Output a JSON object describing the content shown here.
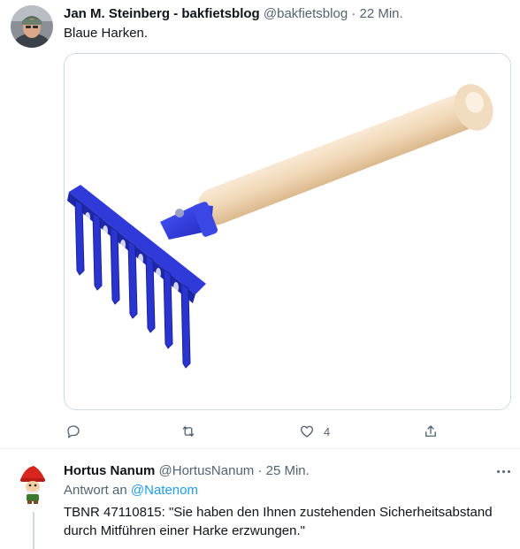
{
  "tweets": [
    {
      "author_name": "Jan M. Steinberg - bakfietsblog",
      "author_handle": "@bakfietsblog",
      "separator": "·",
      "time": "22 Min.",
      "text": "Blaue Harken.",
      "actions": {
        "reply_count": "",
        "retweet_count": "",
        "like_count": "4"
      }
    },
    {
      "author_name": "Hortus Nanum",
      "author_handle": "@HortusNanum",
      "separator": "·",
      "time": "25 Min.",
      "reply_prefix": "Antwort an",
      "reply_mention": "@Natenom",
      "text": "TBNR 47110815: \"Sie haben den Ihnen zustehenden Sicherheitsabstand durch Mitführen einer Harke erzwungen.\""
    }
  ],
  "icons": [
    "avatar-photo",
    "reply-icon",
    "retweet-icon",
    "like-icon",
    "share-icon",
    "more-icon",
    "gnome-avatar"
  ],
  "colors": {
    "accent": "#1d9bf0",
    "text_primary": "#0f1419",
    "text_secondary": "#536471",
    "border": "#cfd9de",
    "rake_blue": "#2a36d4"
  }
}
